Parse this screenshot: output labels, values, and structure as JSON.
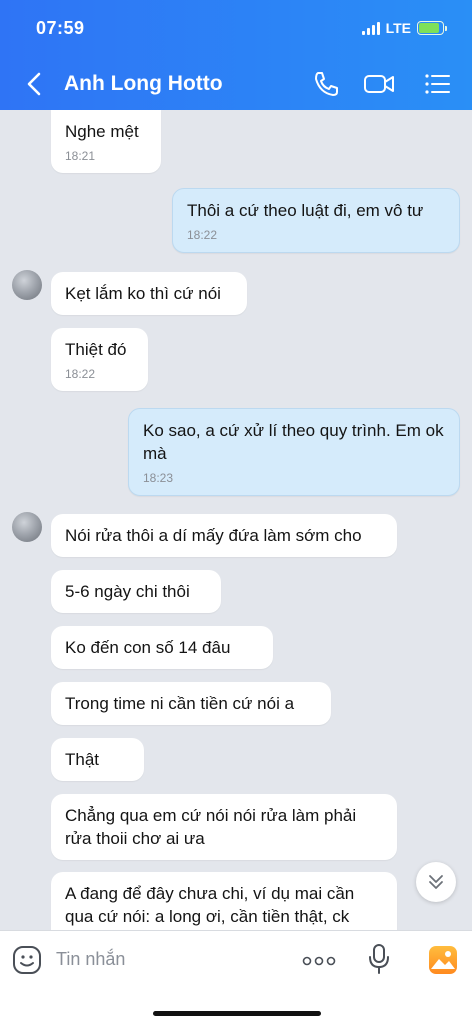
{
  "status_bar": {
    "time": "07:59",
    "network": "LTE",
    "battery_level": 0.85
  },
  "header": {
    "contact_name": "Anh Long Hotto",
    "icons": [
      "back-icon",
      "phone-icon",
      "video-call-icon",
      "menu-icon"
    ]
  },
  "messages": [
    {
      "dir": "in",
      "text": "Nghe mệt",
      "time": "18:21"
    },
    {
      "dir": "out",
      "text": "Thôi a cứ theo luật đi, em vô tư",
      "time": "18:22"
    },
    {
      "dir": "in",
      "text": "Kẹt lắm ko thì cứ nói",
      "time": ""
    },
    {
      "dir": "in",
      "text": "Thiệt đó",
      "time": "18:22"
    },
    {
      "dir": "out",
      "text": "Ko sao, a cứ xử lí theo quy trình. Em ok mà",
      "time": "18:23"
    },
    {
      "dir": "in",
      "text": "Nói rửa thôi a dí mấy đứa làm sớm cho",
      "time": ""
    },
    {
      "dir": "in",
      "text": "5-6 ngày chi thôi",
      "time": ""
    },
    {
      "dir": "in",
      "text": "Ko đến con số 14 đâu",
      "time": ""
    },
    {
      "dir": "in",
      "text": "Trong time ni cần tiền cứ nói a",
      "time": ""
    },
    {
      "dir": "in",
      "text": "Thật",
      "time": ""
    },
    {
      "dir": "in",
      "text": "Chẳng qua em cứ nói nói rửa làm phải rửa thoii chơ ai ưa",
      "time": ""
    },
    {
      "dir": "in",
      "text": "A đang để đây chưa chi, ví dụ mai cần qua cứ nói: a long ơi, cần tiền thật, ck",
      "time": ""
    }
  ],
  "input_bar": {
    "placeholder": "Tin nhắn",
    "icons": [
      "emoji-icon",
      "more-icon",
      "microphone-icon",
      "gallery-icon"
    ]
  },
  "colors": {
    "header_start": "#2f74f5",
    "header_end": "#2a8ff6",
    "outgoing_bubble": "#d5ebfb",
    "incoming_bubble": "#ffffff",
    "chat_bg": "#e3e6ec"
  }
}
